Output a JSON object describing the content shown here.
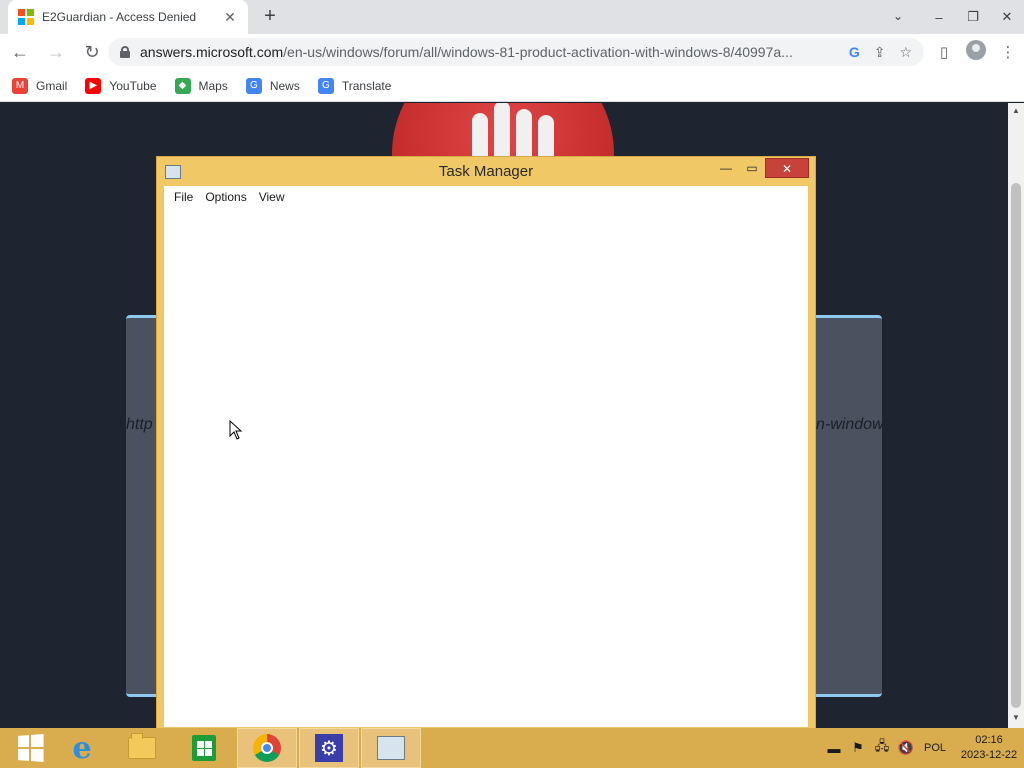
{
  "browser": {
    "tab_title": "E2Guardian - Access Denied",
    "new_tab_label": "+",
    "url_host": "answers.microsoft.com",
    "url_path": "/en-us/windows/forum/all/windows-81-product-activation-with-windows-8/40997a...",
    "bookmarks": [
      {
        "label": "Gmail",
        "icon": "gmail-icon",
        "color": "#ea4335"
      },
      {
        "label": "YouTube",
        "icon": "youtube-icon",
        "color": "#ff0000"
      },
      {
        "label": "Maps",
        "icon": "maps-icon",
        "color": "#34a853"
      },
      {
        "label": "News",
        "icon": "news-icon",
        "color": "#4285f4"
      },
      {
        "label": "Translate",
        "icon": "translate-icon",
        "color": "#4285f4"
      }
    ]
  },
  "page": {
    "blocked_url_left": "http",
    "blocked_url_right": "n-window"
  },
  "task_manager": {
    "title": "Task Manager",
    "menus": [
      "File",
      "Options",
      "View"
    ]
  },
  "taskbar": {
    "language": "POL",
    "time": "02:16",
    "date": "2023-12-22"
  },
  "colors": {
    "accent_window": "#f0c865",
    "close_button": "#c7423a",
    "taskbar": "#d9ad4e",
    "page_bg": "#1f2530"
  }
}
